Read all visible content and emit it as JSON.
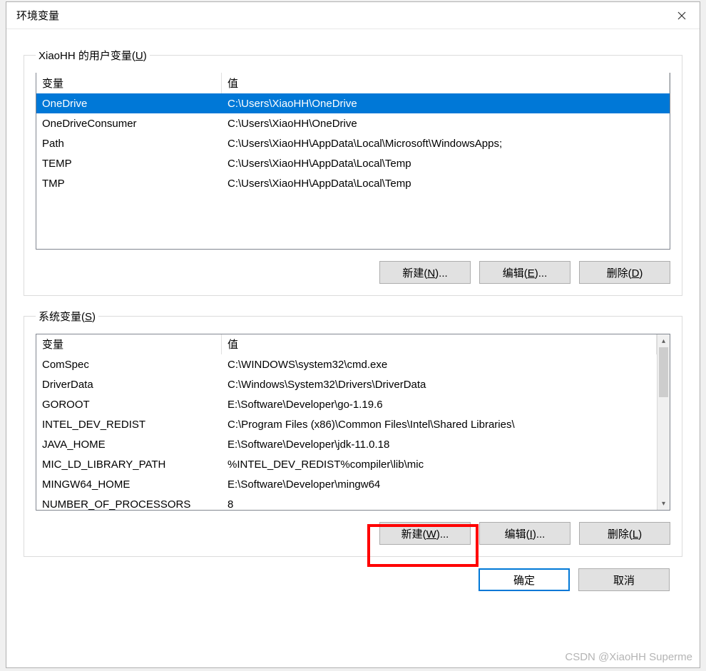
{
  "window": {
    "title": "环境变量"
  },
  "user_section": {
    "legend_prefix": "XiaoHH 的用户变量(",
    "legend_hotkey": "U",
    "legend_suffix": ")",
    "headers": {
      "variable": "变量",
      "value": "值"
    },
    "rows": [
      {
        "name": "OneDrive",
        "value": "C:\\Users\\XiaoHH\\OneDrive",
        "selected": true
      },
      {
        "name": "OneDriveConsumer",
        "value": "C:\\Users\\XiaoHH\\OneDrive"
      },
      {
        "name": "Path",
        "value": "C:\\Users\\XiaoHH\\AppData\\Local\\Microsoft\\WindowsApps;"
      },
      {
        "name": "TEMP",
        "value": "C:\\Users\\XiaoHH\\AppData\\Local\\Temp"
      },
      {
        "name": "TMP",
        "value": "C:\\Users\\XiaoHH\\AppData\\Local\\Temp"
      }
    ],
    "buttons": {
      "new": {
        "label": "新建(",
        "hotkey": "N",
        "suffix": ")..."
      },
      "edit": {
        "label": "编辑(",
        "hotkey": "E",
        "suffix": ")..."
      },
      "delete": {
        "label": "删除(",
        "hotkey": "D",
        "suffix": ")"
      }
    }
  },
  "system_section": {
    "legend_prefix": "系统变量(",
    "legend_hotkey": "S",
    "legend_suffix": ")",
    "headers": {
      "variable": "变量",
      "value": "值"
    },
    "rows": [
      {
        "name": "ComSpec",
        "value": "C:\\WINDOWS\\system32\\cmd.exe"
      },
      {
        "name": "DriverData",
        "value": "C:\\Windows\\System32\\Drivers\\DriverData"
      },
      {
        "name": "GOROOT",
        "value": "E:\\Software\\Developer\\go-1.19.6"
      },
      {
        "name": "INTEL_DEV_REDIST",
        "value": "C:\\Program Files (x86)\\Common Files\\Intel\\Shared Libraries\\"
      },
      {
        "name": "JAVA_HOME",
        "value": "E:\\Software\\Developer\\jdk-11.0.18"
      },
      {
        "name": "MIC_LD_LIBRARY_PATH",
        "value": "%INTEL_DEV_REDIST%compiler\\lib\\mic"
      },
      {
        "name": "MINGW64_HOME",
        "value": "E:\\Software\\Developer\\mingw64"
      },
      {
        "name": "NUMBER_OF_PROCESSORS",
        "value": "8"
      }
    ],
    "buttons": {
      "new": {
        "label": "新建(",
        "hotkey": "W",
        "suffix": ")..."
      },
      "edit": {
        "label": "编辑(",
        "hotkey": "I",
        "suffix": ")..."
      },
      "delete": {
        "label": "删除(",
        "hotkey": "L",
        "suffix": ")"
      }
    }
  },
  "footer": {
    "ok": "确定",
    "cancel": "取消"
  },
  "watermark": "CSDN @XiaoHH Superme"
}
